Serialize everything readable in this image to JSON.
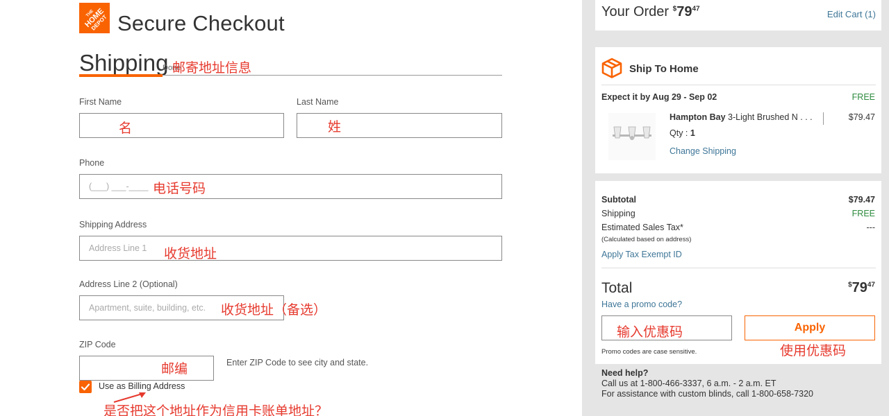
{
  "header": {
    "logo_text": "THE HOME DEPOT",
    "title": "Secure Checkout"
  },
  "shipping": {
    "title": "Shipping",
    "done_label": "Done",
    "annotation": "邮寄地址信息",
    "first_name": {
      "label": "First Name",
      "value": "",
      "annotation": "名"
    },
    "last_name": {
      "label": "Last Name",
      "value": "",
      "annotation": "姓"
    },
    "phone": {
      "label": "Phone",
      "placeholder": "(___) ___-____",
      "annotation": "电话号码"
    },
    "address1": {
      "label": "Shipping Address",
      "placeholder": "Address Line 1",
      "annotation": "收货地址"
    },
    "address2": {
      "label": "Address Line 2 (Optional)",
      "placeholder": "Apartment, suite, building, etc.",
      "annotation": "收货地址（备选）"
    },
    "zip": {
      "label": "ZIP Code",
      "value": "",
      "annotation": "邮编",
      "hint": "Enter ZIP Code to see city and state."
    },
    "billing_checkbox": {
      "label": "Use as Billing Address",
      "checked": true,
      "annotation": "是否把这个地址作为信用卡账单地址？"
    }
  },
  "order": {
    "title": "Your Order",
    "total_dollars": "$79",
    "total_cents": "47",
    "edit_cart": "Edit Cart (1)"
  },
  "ship_to_home": {
    "title": "Ship To Home",
    "expect": "Expect it by Aug 29 - Sep 02",
    "free": "FREE",
    "product": {
      "brand": "Hampton Bay",
      "name": " 3-Light Brushed N . . .",
      "price": "$79.47",
      "qty_label": "Qty : ",
      "qty": "1",
      "change_shipping": "Change Shipping"
    }
  },
  "summary": {
    "subtotal_label": "Subtotal",
    "subtotal_value": "$79.47",
    "shipping_label": "Shipping",
    "shipping_value": "FREE",
    "tax_label": "Estimated Sales Tax*",
    "tax_value": "---",
    "tax_note": "(Calculated based on address)",
    "tax_exempt_link": "Apply Tax Exempt ID",
    "total_label": "Total",
    "total_dollars": "$79",
    "total_cents": "47",
    "promo_link": "Have a promo code?",
    "promo_placeholder": "",
    "promo_annotation": "输入优惠码",
    "apply_label": "Apply",
    "apply_annotation": "使用优惠码",
    "promo_note": "Promo codes are case sensitive."
  },
  "help": {
    "title": "Need help?",
    "line1": "Call us at 1-800-466-3337, 6 a.m. - 2 a.m. ET",
    "line2": "For assistance with custom blinds, call 1-800-658-7320"
  },
  "colors": {
    "brand": "#f96302",
    "link": "#3e7697",
    "free": "#2e8b3e",
    "annotation": "#e63a2e"
  }
}
